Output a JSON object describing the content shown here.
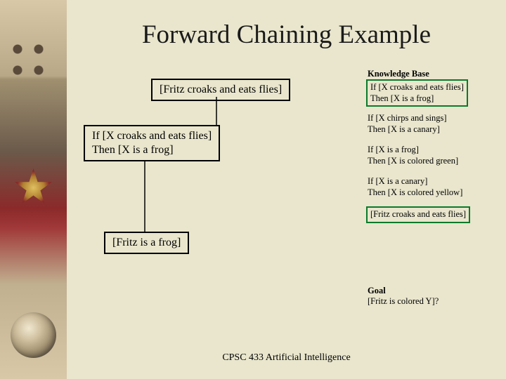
{
  "title": "Forward Chaining Example",
  "footer": "CPSC 433 Artificial Intelligence",
  "fact1": "[Fritz croaks and eats flies]",
  "rule1": "If [X croaks and eats flies]\nThen [X is a frog]",
  "fact2": "[Fritz is a frog]",
  "kb": {
    "header": "Knowledge Base",
    "r1": "If [X croaks and eats flies]\nThen [X is a frog]",
    "r2": "If [X chirps and sings]\nThen [X is a canary]",
    "r3": "If [X is a frog]\nThen [X is colored green]",
    "r4": "If [X is a canary]\nThen [X is colored yellow]",
    "f1": "[Fritz croaks and eats flies]",
    "goalHeader": "Goal",
    "goal": "[Fritz is colored Y]?"
  }
}
